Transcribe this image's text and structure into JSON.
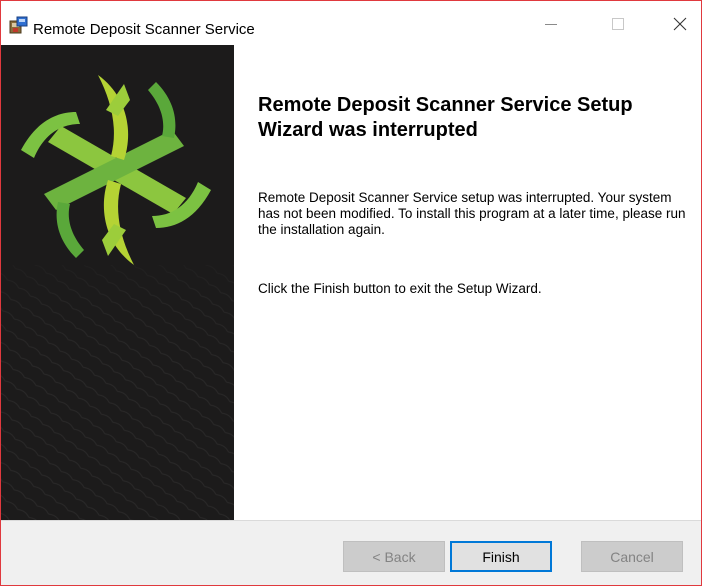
{
  "window": {
    "title": "Remote Deposit Scanner Service",
    "controls": {
      "minimize_icon": "minimize-icon",
      "maximize_icon": "maximize-icon",
      "close_icon": "close-icon"
    },
    "app_icon": "installer-icon"
  },
  "banner": {
    "logo_icon": "green-star-logo",
    "background_color": "#1c1b1b",
    "logo_colors": [
      "#7cc242",
      "#b7d433",
      "#5aa83a"
    ]
  },
  "content": {
    "heading": "Remote Deposit Scanner Service Setup Wizard was interrupted",
    "paragraph_1": "Remote Deposit Scanner Service setup was interrupted. Your system has not been modified. To install this program at a later time, please run the installation again.",
    "paragraph_2": "Click the Finish button to exit the Setup Wizard."
  },
  "buttons": {
    "back": {
      "label": "< Back",
      "enabled": false
    },
    "finish": {
      "label": "Finish",
      "enabled": true,
      "focused": true
    },
    "cancel": {
      "label": "Cancel",
      "enabled": false
    }
  },
  "colors": {
    "window_border": "#e0393e",
    "focus_border": "#0078d7",
    "bottom_bar": "#f0f0f0"
  }
}
